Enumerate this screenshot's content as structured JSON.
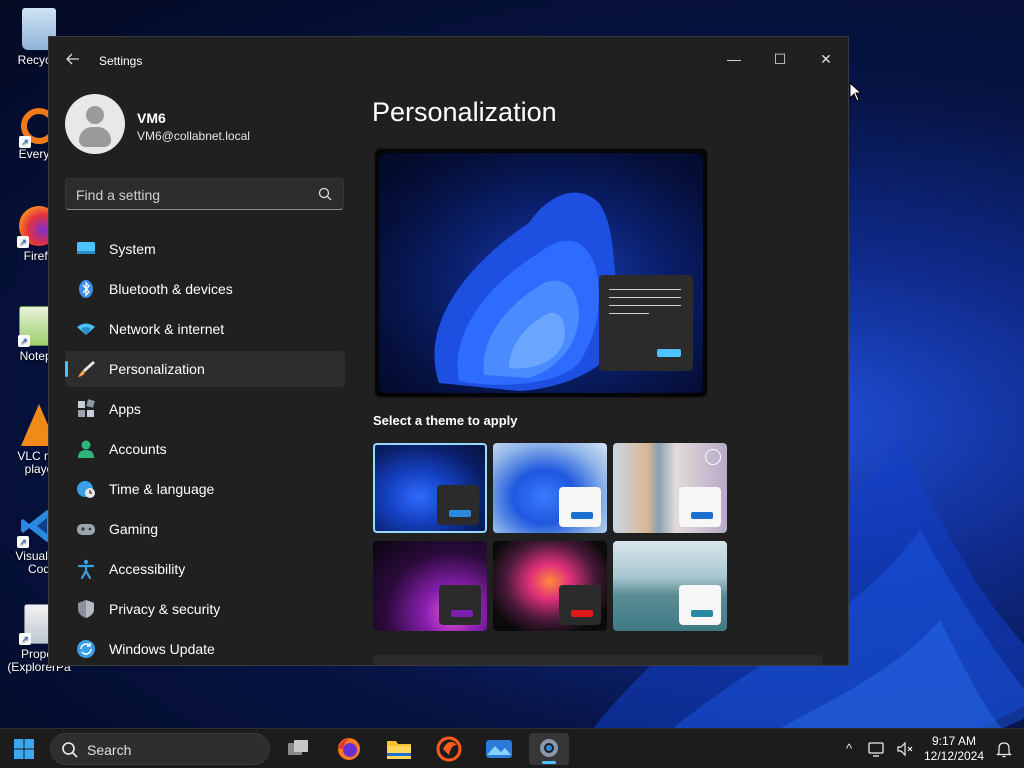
{
  "desktop": {
    "icons": [
      {
        "label": "Recycle",
        "icon": "recycle-bin-icon"
      },
      {
        "label": "Everyth",
        "icon": "everything-search-icon"
      },
      {
        "label": "Firefo",
        "icon": "firefox-icon"
      },
      {
        "label": "Notepa",
        "icon": "notepad-icon"
      },
      {
        "label": "VLC me\nplaye",
        "icon": "vlc-icon"
      },
      {
        "label": "Visual St\nCod",
        "icon": "vscode-icon"
      },
      {
        "label": "Proper\n(ExplorerPa",
        "icon": "properties-icon"
      }
    ]
  },
  "window": {
    "title": "Settings",
    "controls": {
      "minimize": "—",
      "maximize": "☐",
      "close": "✕"
    },
    "user": {
      "name": "VM6",
      "email": "VM6@collabnet.local"
    },
    "search": {
      "placeholder": "Find a setting"
    },
    "nav": [
      {
        "label": "System",
        "icon": "system-icon",
        "color": "#4cc2ff"
      },
      {
        "label": "Bluetooth & devices",
        "icon": "bluetooth-icon",
        "color": "#3a8ee6"
      },
      {
        "label": "Network & internet",
        "icon": "wifi-icon",
        "color": "#4cc2ff"
      },
      {
        "label": "Personalization",
        "icon": "brush-icon",
        "color": "#f0a54a",
        "active": true
      },
      {
        "label": "Apps",
        "icon": "apps-icon",
        "color": "#9aa4b0"
      },
      {
        "label": "Accounts",
        "icon": "person-icon",
        "color": "#2fb67c"
      },
      {
        "label": "Time & language",
        "icon": "globe-clock-icon",
        "color": "#3aa0e6"
      },
      {
        "label": "Gaming",
        "icon": "gamepad-icon",
        "color": "#9aa4b0"
      },
      {
        "label": "Accessibility",
        "icon": "accessibility-icon",
        "color": "#3aa0e6"
      },
      {
        "label": "Privacy & security",
        "icon": "shield-icon",
        "color": "#8a8f99"
      },
      {
        "label": "Windows Update",
        "icon": "update-icon",
        "color": "#3aa0e6"
      }
    ],
    "main": {
      "title": "Personalization",
      "themes_label": "Select a theme to apply",
      "themes": [
        {
          "name": "windows-dark",
          "selected": true
        },
        {
          "name": "windows-light",
          "selected": false
        },
        {
          "name": "spotlight",
          "selected": false
        },
        {
          "name": "glow",
          "selected": false
        },
        {
          "name": "captured-motion",
          "selected": false
        },
        {
          "name": "flow",
          "selected": false
        }
      ]
    }
  },
  "taskbar": {
    "search_label": "Search",
    "apps": [
      "task-view-icon",
      "firefox-icon",
      "file-explorer-icon",
      "app-icon",
      "photos-icon",
      "settings-icon"
    ],
    "active_app": "settings-icon",
    "clock": {
      "time": "9:17 AM",
      "date": "12/12/2024"
    },
    "tray": {
      "chevron": "^",
      "notification": "🔔"
    }
  }
}
